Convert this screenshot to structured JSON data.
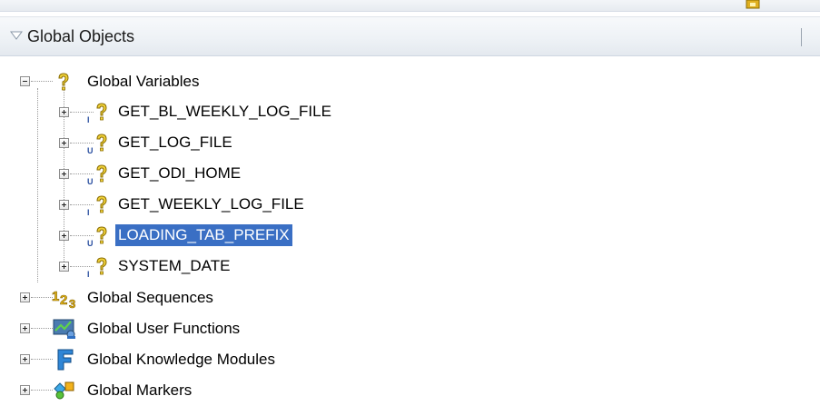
{
  "header": {
    "title": "Global Objects"
  },
  "tree": {
    "variables": {
      "label": "Global Variables",
      "items": [
        {
          "label": "GET_BL_WEEKLY_LOG_FILE",
          "badge": "I",
          "selected": false
        },
        {
          "label": "GET_LOG_FILE",
          "badge": "U",
          "selected": false
        },
        {
          "label": "GET_ODI_HOME",
          "badge": "U",
          "selected": false
        },
        {
          "label": "GET_WEEKLY_LOG_FILE",
          "badge": "I",
          "selected": false
        },
        {
          "label": "LOADING_TAB_PREFIX",
          "badge": "U",
          "selected": true
        },
        {
          "label": "SYSTEM_DATE",
          "badge": "I",
          "selected": false
        }
      ]
    },
    "sequences": {
      "label": "Global Sequences"
    },
    "user_functions": {
      "label": "Global User Functions"
    },
    "knowledge_modules": {
      "label": "Global Knowledge Modules"
    },
    "markers": {
      "label": "Global Markers"
    }
  },
  "colors": {
    "selection": "#3a6fc4",
    "header_bg": "#eef2f6"
  }
}
